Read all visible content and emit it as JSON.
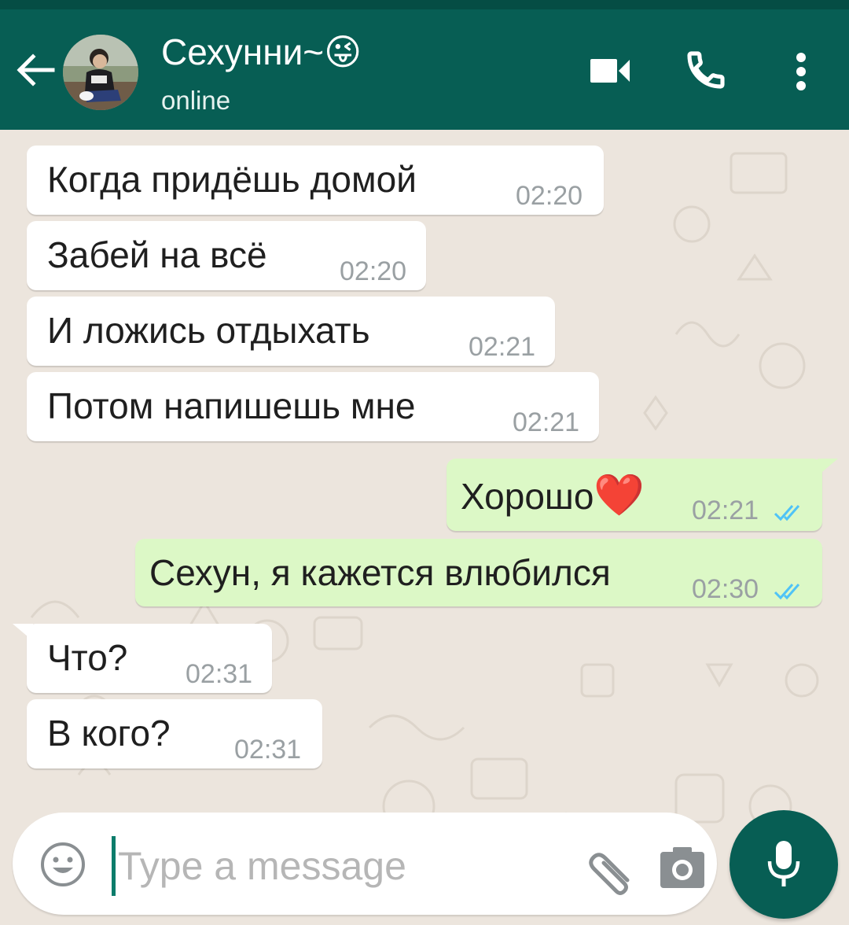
{
  "header": {
    "back_icon": "arrow-left-icon",
    "contact_name": "Сехунни~",
    "contact_emoji": "😜",
    "status": "online",
    "actions": [
      "video-call-icon",
      "phone-icon",
      "more-vert-icon"
    ]
  },
  "messages": [
    {
      "direction": "in",
      "text": "Когда придёшь домой",
      "time": "02:20"
    },
    {
      "direction": "in",
      "text": "Забей на всё",
      "time": "02:20"
    },
    {
      "direction": "in",
      "text": "И ложись отдыхать",
      "time": "02:21"
    },
    {
      "direction": "in",
      "text": "Потом напишешь мне",
      "time": "02:21"
    },
    {
      "direction": "out",
      "text": "Хорошо",
      "emoji": "❤️",
      "time": "02:21",
      "status": "read-double-check"
    },
    {
      "direction": "out",
      "text": "Сехун, я кажется влюбился",
      "time": "02:30",
      "status": "read-double-check"
    },
    {
      "direction": "in",
      "text": "Что?",
      "time": "02:31"
    },
    {
      "direction": "in",
      "text": "В кого?",
      "time": "02:31"
    }
  ],
  "composer": {
    "placeholder": "Type a message",
    "emoji_icon": "smiley-icon",
    "attach_icon": "paperclip-icon",
    "camera_icon": "camera-icon",
    "send_icon": "microphone-icon"
  },
  "colors": {
    "header": "#075e54",
    "status_bar": "#054d44",
    "chat_background": "#ece5dd",
    "incoming_bubble": "#ffffff",
    "outgoing_bubble": "#dcf8c6",
    "read_ticks": "#4fc3f7",
    "mic_button": "#075e54"
  }
}
